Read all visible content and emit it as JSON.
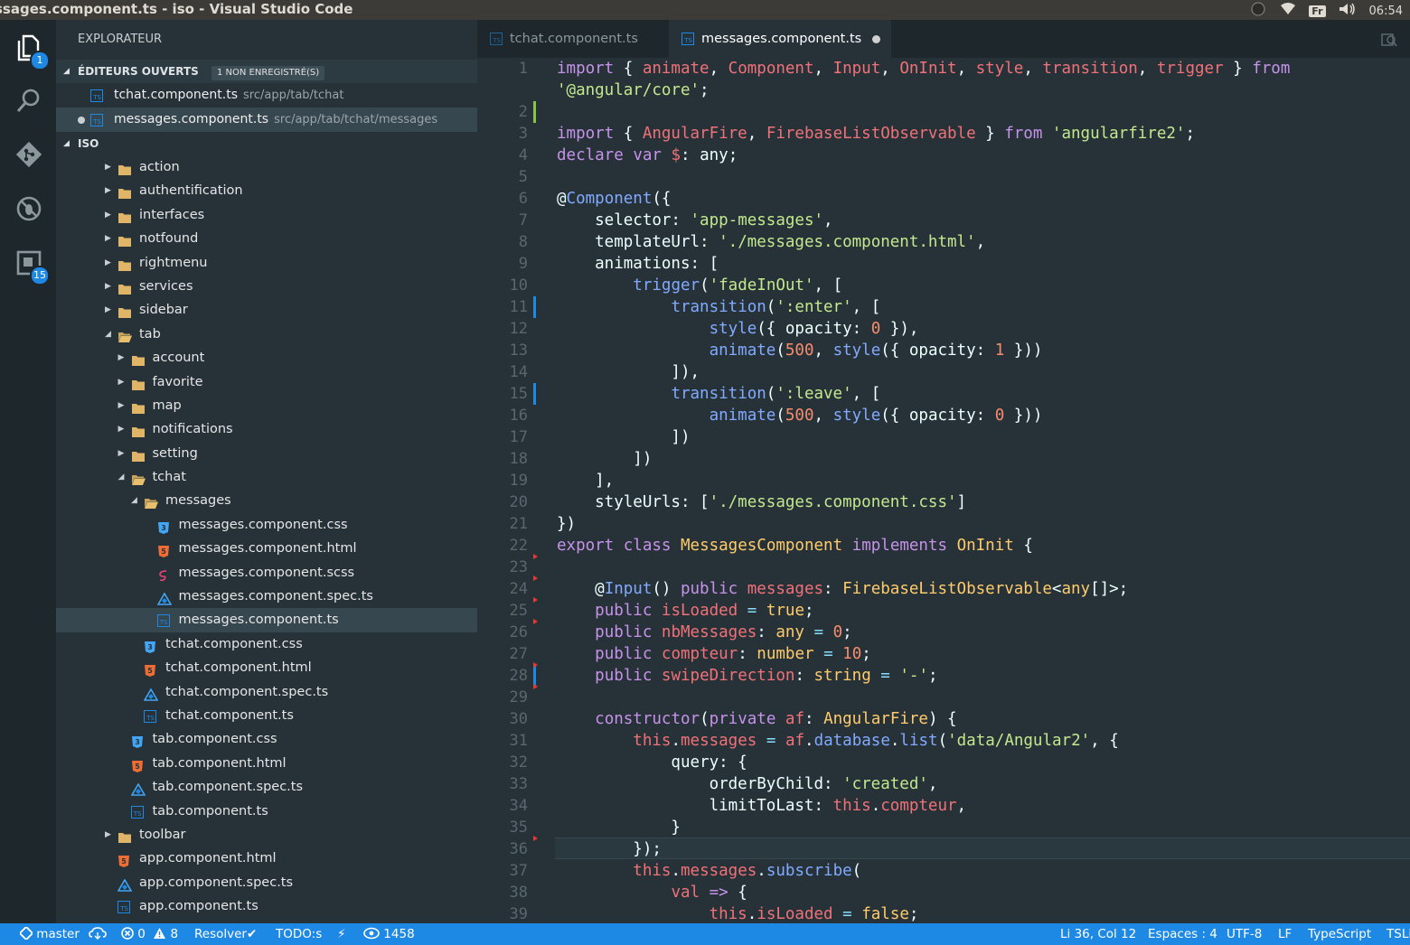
{
  "window": {
    "title": "ssages.component.ts - iso - Visual Studio Code",
    "tray": {
      "keyboard": "Fr",
      "clock": "06:54"
    }
  },
  "activity_bar": {
    "explorer_badge": "1",
    "extensions_badge": "15"
  },
  "sidebar": {
    "title": "EXPLORATEUR",
    "open_editors": {
      "header": "ÉDITEURS OUVERTS",
      "badge": "1 NON ENREGISTRÉ(S)",
      "items": [
        {
          "name": "tchat.component.ts",
          "path": "src/app/tab/tchat"
        },
        {
          "name": "messages.component.ts",
          "path": "src/app/tab/tchat/messages"
        }
      ]
    },
    "project": {
      "header": "ISO",
      "tree": [
        {
          "label": "action",
          "type": "folder"
        },
        {
          "label": "authentification",
          "type": "folder"
        },
        {
          "label": "interfaces",
          "type": "folder"
        },
        {
          "label": "notfound",
          "type": "folder"
        },
        {
          "label": "rightmenu",
          "type": "folder"
        },
        {
          "label": "services",
          "type": "folder"
        },
        {
          "label": "sidebar",
          "type": "folder"
        },
        {
          "label": "tab",
          "type": "folder-open"
        },
        {
          "label": "account",
          "type": "folder"
        },
        {
          "label": "favorite",
          "type": "folder"
        },
        {
          "label": "map",
          "type": "folder"
        },
        {
          "label": "notifications",
          "type": "folder"
        },
        {
          "label": "setting",
          "type": "folder"
        },
        {
          "label": "tchat",
          "type": "folder-open"
        },
        {
          "label": "messages",
          "type": "folder-open"
        },
        {
          "label": "messages.component.css",
          "type": "css-file"
        },
        {
          "label": "messages.component.html",
          "type": "html-file"
        },
        {
          "label": "messages.component.scss",
          "type": "scss-file"
        },
        {
          "label": "messages.component.spec.ts",
          "type": "spec-file"
        },
        {
          "label": "messages.component.ts",
          "type": "ts-file"
        },
        {
          "label": "tchat.component.css",
          "type": "css-file"
        },
        {
          "label": "tchat.component.html",
          "type": "html-file"
        },
        {
          "label": "tchat.component.spec.ts",
          "type": "spec-file"
        },
        {
          "label": "tchat.component.ts",
          "type": "ts-file"
        },
        {
          "label": "tab.component.css",
          "type": "css-file"
        },
        {
          "label": "tab.component.html",
          "type": "html-file"
        },
        {
          "label": "tab.component.spec.ts",
          "type": "spec-file"
        },
        {
          "label": "tab.component.ts",
          "type": "ts-file"
        },
        {
          "label": "toolbar",
          "type": "folder"
        },
        {
          "label": "app.component.html",
          "type": "html-file"
        },
        {
          "label": "app.component.spec.ts",
          "type": "spec-file"
        },
        {
          "label": "app.component.ts",
          "type": "ts-file"
        }
      ]
    }
  },
  "editor": {
    "tabs": [
      {
        "label": "tchat.component.ts"
      },
      {
        "label": "messages.component.ts"
      }
    ],
    "line_numbers": [
      "1",
      "",
      "2",
      "3",
      "4",
      "5",
      "6",
      "7",
      "8",
      "9",
      "10",
      "11",
      "12",
      "13",
      "14",
      "15",
      "16",
      "17",
      "18",
      "19",
      "20",
      "21",
      "22",
      "23",
      "24",
      "25",
      "26",
      "27",
      "28",
      "29",
      "30",
      "31",
      "32",
      "33",
      "34",
      "35",
      "36",
      "37",
      "38",
      "39"
    ],
    "code_lines": [
      [
        [
          "k",
          "import"
        ],
        [
          "p",
          " { "
        ],
        [
          "v",
          "animate"
        ],
        [
          "p",
          ", "
        ],
        [
          "v",
          "Component"
        ],
        [
          "p",
          ", "
        ],
        [
          "v",
          "Input"
        ],
        [
          "p",
          ", "
        ],
        [
          "v",
          "OnInit"
        ],
        [
          "p",
          ", "
        ],
        [
          "v",
          "style"
        ],
        [
          "p",
          ", "
        ],
        [
          "v",
          "transition"
        ],
        [
          "p",
          ", "
        ],
        [
          "v",
          "trigger"
        ],
        [
          "p",
          " } "
        ],
        [
          "k",
          "from"
        ]
      ],
      [
        [
          "s",
          "'@angular/core'"
        ],
        [
          "p",
          ";"
        ]
      ],
      [],
      [
        [
          "k",
          "import"
        ],
        [
          "p",
          " { "
        ],
        [
          "v",
          "AngularFire"
        ],
        [
          "p",
          ", "
        ],
        [
          "v",
          "FirebaseListObservable"
        ],
        [
          "p",
          " } "
        ],
        [
          "k",
          "from"
        ],
        [
          "p",
          " "
        ],
        [
          "s",
          "'angularfire2'"
        ],
        [
          "p",
          ";"
        ]
      ],
      [
        [
          "k",
          "declare"
        ],
        [
          "p",
          " "
        ],
        [
          "k",
          "var"
        ],
        [
          "p",
          " "
        ],
        [
          "v",
          "$"
        ],
        [
          "p",
          ": any;"
        ]
      ],
      [],
      [
        [
          "p",
          "@"
        ],
        [
          "f",
          "Component"
        ],
        [
          "p",
          "({"
        ]
      ],
      [
        [
          "p",
          "    selector: "
        ],
        [
          "s",
          "'app-messages'"
        ],
        [
          "p",
          ","
        ]
      ],
      [
        [
          "p",
          "    templateUrl: "
        ],
        [
          "s",
          "'./messages.component.html'"
        ],
        [
          "p",
          ","
        ]
      ],
      [
        [
          "p",
          "    animations: ["
        ]
      ],
      [
        [
          "p",
          "        "
        ],
        [
          "f",
          "trigger"
        ],
        [
          "p",
          "("
        ],
        [
          "s",
          "'fadeInOut'"
        ],
        [
          "p",
          ", ["
        ]
      ],
      [
        [
          "p",
          "            "
        ],
        [
          "f",
          "transition"
        ],
        [
          "p",
          "("
        ],
        [
          "s",
          "':enter'"
        ],
        [
          "p",
          ", ["
        ]
      ],
      [
        [
          "p",
          "                "
        ],
        [
          "f",
          "style"
        ],
        [
          "p",
          "({ opacity: "
        ],
        [
          "n",
          "0"
        ],
        [
          "p",
          " }),"
        ]
      ],
      [
        [
          "p",
          "                "
        ],
        [
          "f",
          "animate"
        ],
        [
          "p",
          "("
        ],
        [
          "n",
          "500"
        ],
        [
          "p",
          ", "
        ],
        [
          "f",
          "style"
        ],
        [
          "p",
          "({ opacity: "
        ],
        [
          "n",
          "1"
        ],
        [
          "p",
          " }))"
        ]
      ],
      [
        [
          "p",
          "            ]),"
        ]
      ],
      [
        [
          "p",
          "            "
        ],
        [
          "f",
          "transition"
        ],
        [
          "p",
          "("
        ],
        [
          "s",
          "':leave'"
        ],
        [
          "p",
          ", ["
        ]
      ],
      [
        [
          "p",
          "                "
        ],
        [
          "f",
          "animate"
        ],
        [
          "p",
          "("
        ],
        [
          "n",
          "500"
        ],
        [
          "p",
          ", "
        ],
        [
          "f",
          "style"
        ],
        [
          "p",
          "({ opacity: "
        ],
        [
          "n",
          "0"
        ],
        [
          "p",
          " }))"
        ]
      ],
      [
        [
          "p",
          "            ])"
        ]
      ],
      [
        [
          "p",
          "        ])"
        ]
      ],
      [
        [
          "p",
          "    ],"
        ]
      ],
      [
        [
          "p",
          "    styleUrls: ["
        ],
        [
          "s",
          "'./messages.component.css'"
        ],
        [
          "p",
          "]"
        ]
      ],
      [
        [
          "p",
          "})"
        ]
      ],
      [
        [
          "k",
          "export"
        ],
        [
          "p",
          " "
        ],
        [
          "k",
          "class"
        ],
        [
          "p",
          " "
        ],
        [
          "c",
          "MessagesComponent"
        ],
        [
          "p",
          " "
        ],
        [
          "k",
          "implements"
        ],
        [
          "p",
          " "
        ],
        [
          "c",
          "OnInit"
        ],
        [
          "p",
          " {"
        ]
      ],
      [],
      [
        [
          "p",
          "    @"
        ],
        [
          "f",
          "Input"
        ],
        [
          "p",
          "() "
        ],
        [
          "k",
          "public"
        ],
        [
          "p",
          " "
        ],
        [
          "v",
          "messages"
        ],
        [
          "p",
          ": "
        ],
        [
          "c",
          "FirebaseListObservable"
        ],
        [
          "p",
          "<"
        ],
        [
          "c",
          "any"
        ],
        [
          "p",
          "[]>;"
        ]
      ],
      [
        [
          "p",
          "    "
        ],
        [
          "k",
          "public"
        ],
        [
          "p",
          " "
        ],
        [
          "v",
          "isLoaded"
        ],
        [
          "p",
          " "
        ],
        [
          "o",
          "="
        ],
        [
          "p",
          " "
        ],
        [
          "c",
          "true"
        ],
        [
          "p",
          ";"
        ]
      ],
      [
        [
          "p",
          "    "
        ],
        [
          "k",
          "public"
        ],
        [
          "p",
          " "
        ],
        [
          "v",
          "nbMessages"
        ],
        [
          "p",
          ": "
        ],
        [
          "c",
          "any"
        ],
        [
          "p",
          " "
        ],
        [
          "o",
          "="
        ],
        [
          "p",
          " "
        ],
        [
          "n",
          "0"
        ],
        [
          "p",
          ";"
        ]
      ],
      [
        [
          "p",
          "    "
        ],
        [
          "k",
          "public"
        ],
        [
          "p",
          " "
        ],
        [
          "v",
          "compteur"
        ],
        [
          "p",
          ": "
        ],
        [
          "c",
          "number"
        ],
        [
          "p",
          " "
        ],
        [
          "o",
          "="
        ],
        [
          "p",
          " "
        ],
        [
          "n",
          "10"
        ],
        [
          "p",
          ";"
        ]
      ],
      [
        [
          "p",
          "    "
        ],
        [
          "k",
          "public"
        ],
        [
          "p",
          " "
        ],
        [
          "v",
          "swipeDirection"
        ],
        [
          "p",
          ": "
        ],
        [
          "c",
          "string"
        ],
        [
          "p",
          " "
        ],
        [
          "o",
          "="
        ],
        [
          "p",
          " "
        ],
        [
          "s",
          "'-'"
        ],
        [
          "p",
          ";"
        ]
      ],
      [],
      [
        [
          "p",
          "    "
        ],
        [
          "k",
          "constructor"
        ],
        [
          "p",
          "("
        ],
        [
          "k",
          "private"
        ],
        [
          "p",
          " "
        ],
        [
          "v",
          "af"
        ],
        [
          "p",
          ": "
        ],
        [
          "c",
          "AngularFire"
        ],
        [
          "p",
          ") {"
        ]
      ],
      [
        [
          "p",
          "        "
        ],
        [
          "v",
          "this"
        ],
        [
          "p",
          "."
        ],
        [
          "v",
          "messages"
        ],
        [
          "p",
          " "
        ],
        [
          "o",
          "="
        ],
        [
          "p",
          " "
        ],
        [
          "v",
          "af"
        ],
        [
          "p",
          "."
        ],
        [
          "f",
          "database"
        ],
        [
          "p",
          "."
        ],
        [
          "f",
          "list"
        ],
        [
          "p",
          "("
        ],
        [
          "s",
          "'data/Angular2'"
        ],
        [
          "p",
          ", {"
        ]
      ],
      [
        [
          "p",
          "            query: {"
        ]
      ],
      [
        [
          "p",
          "                orderByChild: "
        ],
        [
          "s",
          "'created'"
        ],
        [
          "p",
          ","
        ]
      ],
      [
        [
          "p",
          "                limitToLast: "
        ],
        [
          "v",
          "this"
        ],
        [
          "p",
          "."
        ],
        [
          "v",
          "compteur"
        ],
        [
          "p",
          ","
        ]
      ],
      [
        [
          "p",
          "            }"
        ]
      ],
      [
        [
          "p",
          "        });"
        ]
      ],
      [
        [
          "p",
          "        "
        ],
        [
          "v",
          "this"
        ],
        [
          "p",
          "."
        ],
        [
          "v",
          "messages"
        ],
        [
          "p",
          "."
        ],
        [
          "f",
          "subscribe"
        ],
        [
          "p",
          "("
        ]
      ],
      [
        [
          "p",
          "            "
        ],
        [
          "v",
          "val"
        ],
        [
          "p",
          " "
        ],
        [
          "k",
          "=>"
        ],
        [
          "p",
          " {"
        ]
      ],
      [
        [
          "p",
          "                "
        ],
        [
          "v",
          "this"
        ],
        [
          "p",
          "."
        ],
        [
          "v",
          "isLoaded"
        ],
        [
          "p",
          " "
        ],
        [
          "o",
          "="
        ],
        [
          "p",
          " "
        ],
        [
          "c",
          "false"
        ],
        [
          "p",
          ";"
        ]
      ]
    ]
  },
  "status_bar": {
    "branch": "master",
    "errors": "0",
    "warnings": "8",
    "resolver": "Resolver",
    "todo": "TODO:s",
    "views": "1458",
    "cursor": "Li 36, Col 12",
    "spaces": "Espaces : 4",
    "encoding": "UTF-8",
    "eol": "LF",
    "language": "TypeScript",
    "lint": "TSLi"
  },
  "colors": {
    "accent": "#1e88e5",
    "background": "#263238",
    "keyword": "#c792ea",
    "variable": "#f07178",
    "string": "#c3e88d",
    "function": "#82aaff",
    "number": "#f78c6c",
    "type": "#ffcb6b"
  }
}
